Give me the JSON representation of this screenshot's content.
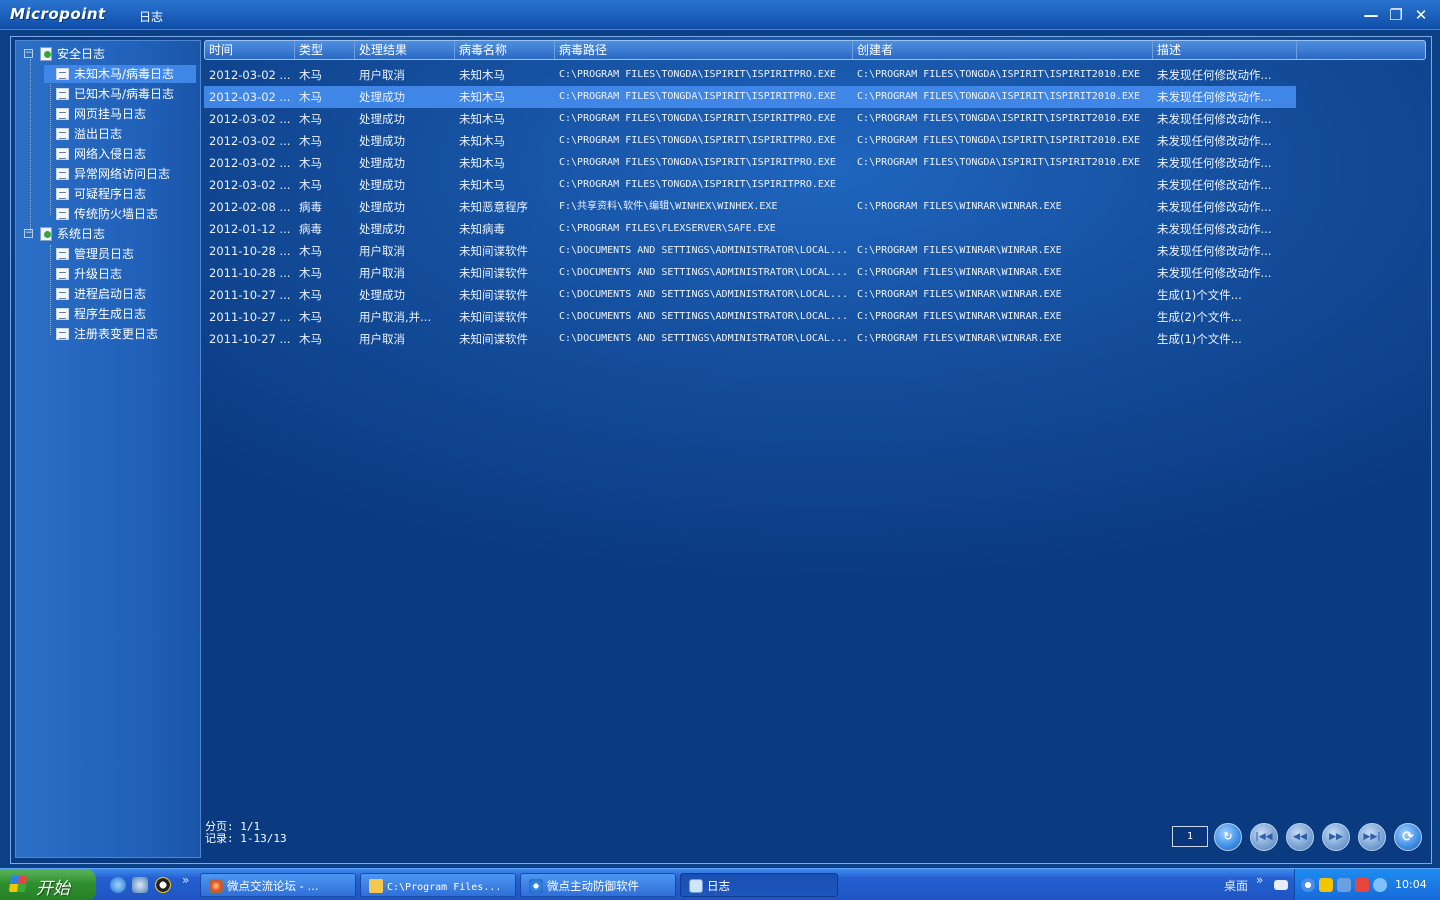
{
  "app": {
    "logo": "Micropoint",
    "window_title": "日志"
  },
  "window_controls": {
    "minimize": "—",
    "restore": "❐",
    "close": "✕"
  },
  "tree": {
    "roots": [
      {
        "label": "安全日志",
        "children": [
          "未知木马/病毒日志",
          "已知木马/病毒日志",
          "网页挂马日志",
          "溢出日志",
          "网络入侵日志",
          "异常网络访问日志",
          "可疑程序日志",
          "传统防火墙日志"
        ]
      },
      {
        "label": "系统日志",
        "children": [
          "管理员日志",
          "升级日志",
          "进程启动日志",
          "程序生成日志",
          "注册表变更日志"
        ]
      }
    ],
    "selected": "未知木马/病毒日志",
    "expand_symbol": "−"
  },
  "grid": {
    "columns": [
      "时间",
      "类型",
      "处理结果",
      "病毒名称",
      "病毒路径",
      "创建者",
      "描述"
    ],
    "rows": [
      [
        "2012-03-02 ...",
        "木马",
        "用户取消",
        "未知木马",
        "C:\\PROGRAM FILES\\TONGDA\\ISPIRIT\\ISPIRITPRO.EXE",
        "C:\\PROGRAM FILES\\TONGDA\\ISPIRIT\\ISPIRIT2010.EXE",
        "未发现任何修改动作..."
      ],
      [
        "2012-03-02 ...",
        "木马",
        "处理成功",
        "未知木马",
        "C:\\PROGRAM FILES\\TONGDA\\ISPIRIT\\ISPIRITPRO.EXE",
        "C:\\PROGRAM FILES\\TONGDA\\ISPIRIT\\ISPIRIT2010.EXE",
        "未发现任何修改动作..."
      ],
      [
        "2012-03-02 ...",
        "木马",
        "处理成功",
        "未知木马",
        "C:\\PROGRAM FILES\\TONGDA\\ISPIRIT\\ISPIRITPRO.EXE",
        "C:\\PROGRAM FILES\\TONGDA\\ISPIRIT\\ISPIRIT2010.EXE",
        "未发现任何修改动作..."
      ],
      [
        "2012-03-02 ...",
        "木马",
        "处理成功",
        "未知木马",
        "C:\\PROGRAM FILES\\TONGDA\\ISPIRIT\\ISPIRITPRO.EXE",
        "C:\\PROGRAM FILES\\TONGDA\\ISPIRIT\\ISPIRIT2010.EXE",
        "未发现任何修改动作..."
      ],
      [
        "2012-03-02 ...",
        "木马",
        "处理成功",
        "未知木马",
        "C:\\PROGRAM FILES\\TONGDA\\ISPIRIT\\ISPIRITPRO.EXE",
        "C:\\PROGRAM FILES\\TONGDA\\ISPIRIT\\ISPIRIT2010.EXE",
        "未发现任何修改动作..."
      ],
      [
        "2012-03-02 ...",
        "木马",
        "处理成功",
        "未知木马",
        "C:\\PROGRAM FILES\\TONGDA\\ISPIRIT\\ISPIRITPRO.EXE",
        "",
        "未发现任何修改动作..."
      ],
      [
        "2012-02-08 ...",
        "病毒",
        "处理成功",
        "未知恶意程序",
        "F:\\共享资料\\软件\\编辑\\WINHEX\\WINHEX.EXE",
        "C:\\PROGRAM FILES\\WINRAR\\WINRAR.EXE",
        "未发现任何修改动作..."
      ],
      [
        "2012-01-12 ...",
        "病毒",
        "处理成功",
        "未知病毒",
        "C:\\PROGRAM FILES\\FLEXSERVER\\SAFE.EXE",
        "",
        "未发现任何修改动作..."
      ],
      [
        "2011-10-28 ...",
        "木马",
        "用户取消",
        "未知间谍软件",
        "C:\\DOCUMENTS AND SETTINGS\\ADMINISTRATOR\\LOCAL...",
        "C:\\PROGRAM FILES\\WINRAR\\WINRAR.EXE",
        "未发现任何修改动作..."
      ],
      [
        "2011-10-28 ...",
        "木马",
        "用户取消",
        "未知间谍软件",
        "C:\\DOCUMENTS AND SETTINGS\\ADMINISTRATOR\\LOCAL...",
        "C:\\PROGRAM FILES\\WINRAR\\WINRAR.EXE",
        "未发现任何修改动作..."
      ],
      [
        "2011-10-27 ...",
        "木马",
        "处理成功",
        "未知间谍软件",
        "C:\\DOCUMENTS AND SETTINGS\\ADMINISTRATOR\\LOCAL...",
        "C:\\PROGRAM FILES\\WINRAR\\WINRAR.EXE",
        "生成(1)个文件..."
      ],
      [
        "2011-10-27 ...",
        "木马",
        "用户取消,并...",
        "未知间谍软件",
        "C:\\DOCUMENTS AND SETTINGS\\ADMINISTRATOR\\LOCAL...",
        "C:\\PROGRAM FILES\\WINRAR\\WINRAR.EXE",
        "生成(2)个文件..."
      ],
      [
        "2011-10-27 ...",
        "木马",
        "用户取消",
        "未知间谍软件",
        "C:\\DOCUMENTS AND SETTINGS\\ADMINISTRATOR\\LOCAL...",
        "C:\\PROGRAM FILES\\WINRAR\\WINRAR.EXE",
        "生成(1)个文件..."
      ]
    ],
    "selected_row": 1
  },
  "footer": {
    "page_line": "分页: 1/1",
    "records_line": "记录: 1-13/13",
    "page_input_value": "1",
    "nav": {
      "go": "↻",
      "first": "|◀◀",
      "prev": "◀◀",
      "next": "▶▶",
      "last": "▶▶|",
      "refresh": "⟳"
    }
  },
  "taskbar": {
    "start_label": "开始",
    "quicklaunch_more": "»",
    "tasks": [
      {
        "label": "微点交流论坛 - ...",
        "active": false
      },
      {
        "label": "C:\\Program Files...",
        "active": false
      },
      {
        "label": "微点主动防御软件",
        "active": false
      },
      {
        "label": "日志",
        "active": true
      }
    ],
    "desktop_label": "桌面",
    "tray_more": "»",
    "clock": "10:04"
  },
  "colors": {
    "frame_bg": "#154f9e",
    "selected_row": "#3f86e6",
    "taskbar": "#245fd0",
    "start_green": "#2f8f2f"
  }
}
